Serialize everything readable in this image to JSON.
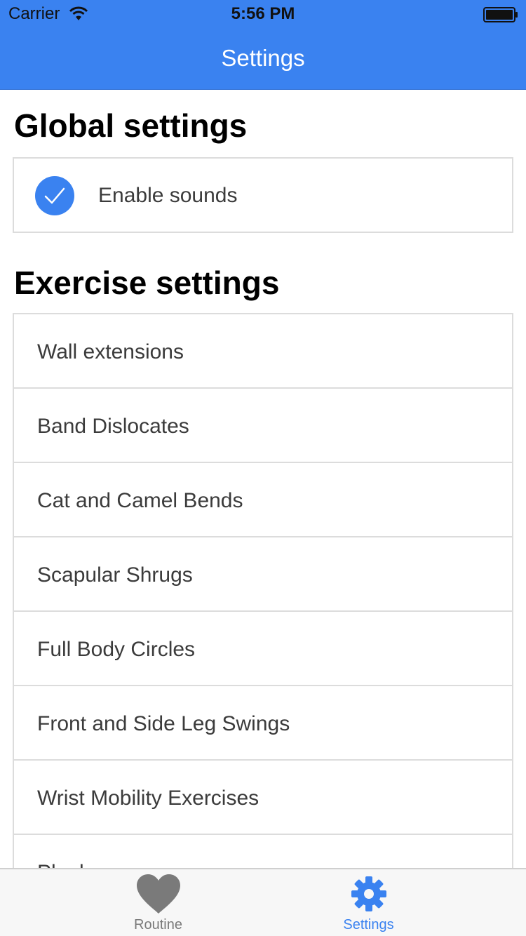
{
  "status_bar": {
    "carrier": "Carrier",
    "time": "5:56 PM",
    "icons": [
      "wifi-icon",
      "battery-icon"
    ]
  },
  "navbar": {
    "title": "Settings",
    "color": "#3a82f0"
  },
  "global_settings": {
    "heading": "Global settings",
    "enable_sounds": {
      "label": "Enable sounds",
      "checked": true,
      "icon": "checkmark-icon"
    }
  },
  "exercise_settings": {
    "heading": "Exercise settings",
    "items": [
      {
        "label": "Wall extensions"
      },
      {
        "label": "Band Dislocates"
      },
      {
        "label": "Cat and Camel Bends"
      },
      {
        "label": "Scapular Shrugs"
      },
      {
        "label": "Full Body Circles"
      },
      {
        "label": "Front and Side Leg Swings"
      },
      {
        "label": "Wrist Mobility Exercises"
      },
      {
        "label": "Planks"
      }
    ]
  },
  "tabbar": {
    "tabs": [
      {
        "label": "Routine",
        "icon": "heart-icon",
        "active": false,
        "color": "#7a7a7a"
      },
      {
        "label": "Settings",
        "icon": "gear-icon",
        "active": true,
        "color": "#3a82f0"
      }
    ]
  }
}
